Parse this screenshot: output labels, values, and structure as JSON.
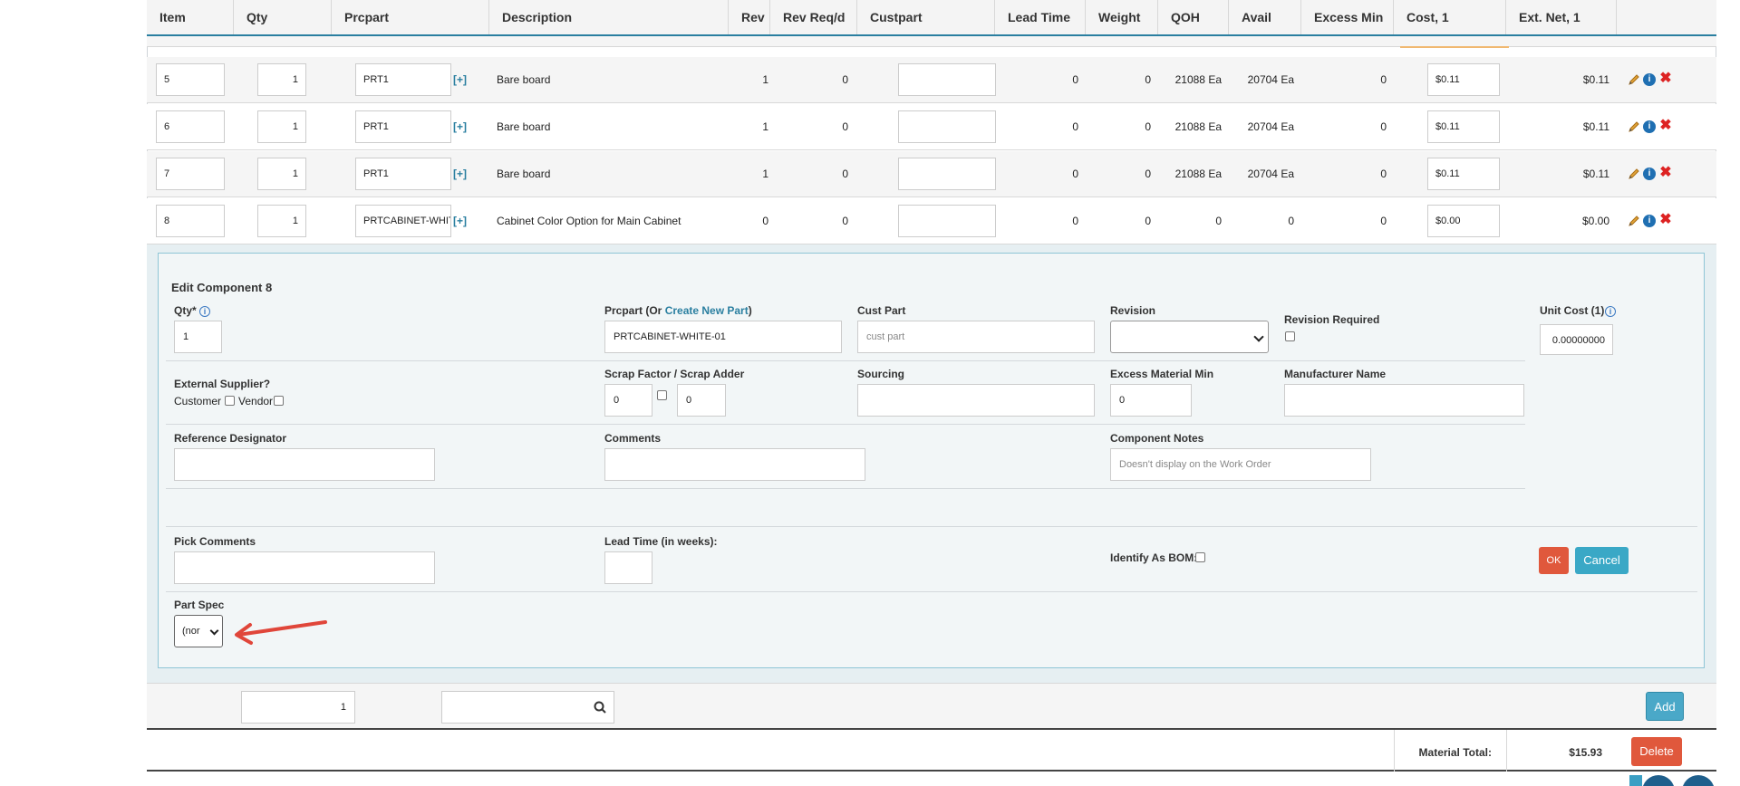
{
  "columns": [
    "Item",
    "Qty",
    "Prcpart",
    "Description",
    "Rev",
    "Rev Req/d",
    "Custpart",
    "Lead Time",
    "Weight",
    "QOH",
    "Avail",
    "Excess Min",
    "Cost, 1",
    "Ext. Net, 1"
  ],
  "rows": [
    {
      "item": "5",
      "qty": "1",
      "prcpart": "PRT1",
      "plus": "[+]",
      "description": "Bare board",
      "rev": "1",
      "rev_req": "0",
      "lead_time": "0",
      "weight": "0",
      "qoh": "21088 Ea",
      "avail": "20704 Ea",
      "excess_min": "0",
      "cost": "$0.11",
      "ext_net": "$0.11"
    },
    {
      "item": "6",
      "qty": "1",
      "prcpart": "PRT1",
      "plus": "[+]",
      "description": "Bare board",
      "rev": "1",
      "rev_req": "0",
      "lead_time": "0",
      "weight": "0",
      "qoh": "21088 Ea",
      "avail": "20704 Ea",
      "excess_min": "0",
      "cost": "$0.11",
      "ext_net": "$0.11"
    },
    {
      "item": "7",
      "qty": "1",
      "prcpart": "PRT1",
      "plus": "[+]",
      "description": "Bare board",
      "rev": "1",
      "rev_req": "0",
      "lead_time": "0",
      "weight": "0",
      "qoh": "21088 Ea",
      "avail": "20704 Ea",
      "excess_min": "0",
      "cost": "$0.11",
      "ext_net": "$0.11"
    },
    {
      "item": "8",
      "qty": "1",
      "prcpart": "PRTCABINET-WHITE",
      "plus": "[+]",
      "description": "Cabinet Color Option for Main Cabinet",
      "rev": "0",
      "rev_req": "0",
      "lead_time": "0",
      "weight": "0",
      "qoh": "0",
      "avail": "0",
      "excess_min": "0",
      "cost": "$0.00",
      "ext_net": "$0.00"
    }
  ],
  "edit": {
    "title": "Edit Component 8",
    "qty_label": "Qty",
    "required_mark": "*",
    "qty_value": "1",
    "prcpart_label": "Prcpart (Or ",
    "create_new_part": "Create New Part",
    "prcpart_label_close": ")",
    "prcpart_value": "PRTCABINET-WHITE-01",
    "custpart_label": "Cust Part",
    "custpart_placeholder": "cust part",
    "revision_label": "Revision",
    "revision_required_label": "Revision Required",
    "unit_cost_label": "Unit Cost (1)",
    "unit_cost_value": "0.00000000",
    "external_supplier_label": "External Supplier?",
    "customer_label": "Customer",
    "vendor_label": "Vendor",
    "scrap_label": "Scrap Factor / Scrap Adder",
    "scrap_factor": "0",
    "scrap_adder": "0",
    "sourcing_label": "Sourcing",
    "excess_label": "Excess Material Min",
    "excess_value": "0",
    "manufacturer_label": "Manufacturer Name",
    "refdes_label": "Reference Designator",
    "comments_label": "Comments",
    "component_notes_label": "Component Notes",
    "component_notes_placeholder": "Doesn't display on the Work Order",
    "pick_comments_label": "Pick Comments",
    "lead_time_label": "Lead Time (in weeks):",
    "identify_bom_label": "Identify As BOM:",
    "ok_label": "OK",
    "cancel_label": "Cancel",
    "part_spec_label": "Part Spec",
    "part_spec_value": "(nor"
  },
  "footer": {
    "qty_value": "1",
    "add_label": "Add",
    "material_total_label": "Material Total:",
    "material_total_value": "$15.93",
    "delete_label": "Delete"
  },
  "colors": {
    "accent": "#2a7fa0",
    "ok": "#e0583c",
    "cancel": "#3aa8c6",
    "add": "#4aa8c8",
    "delete": "#e0583c",
    "arrow": "#e0463a"
  }
}
